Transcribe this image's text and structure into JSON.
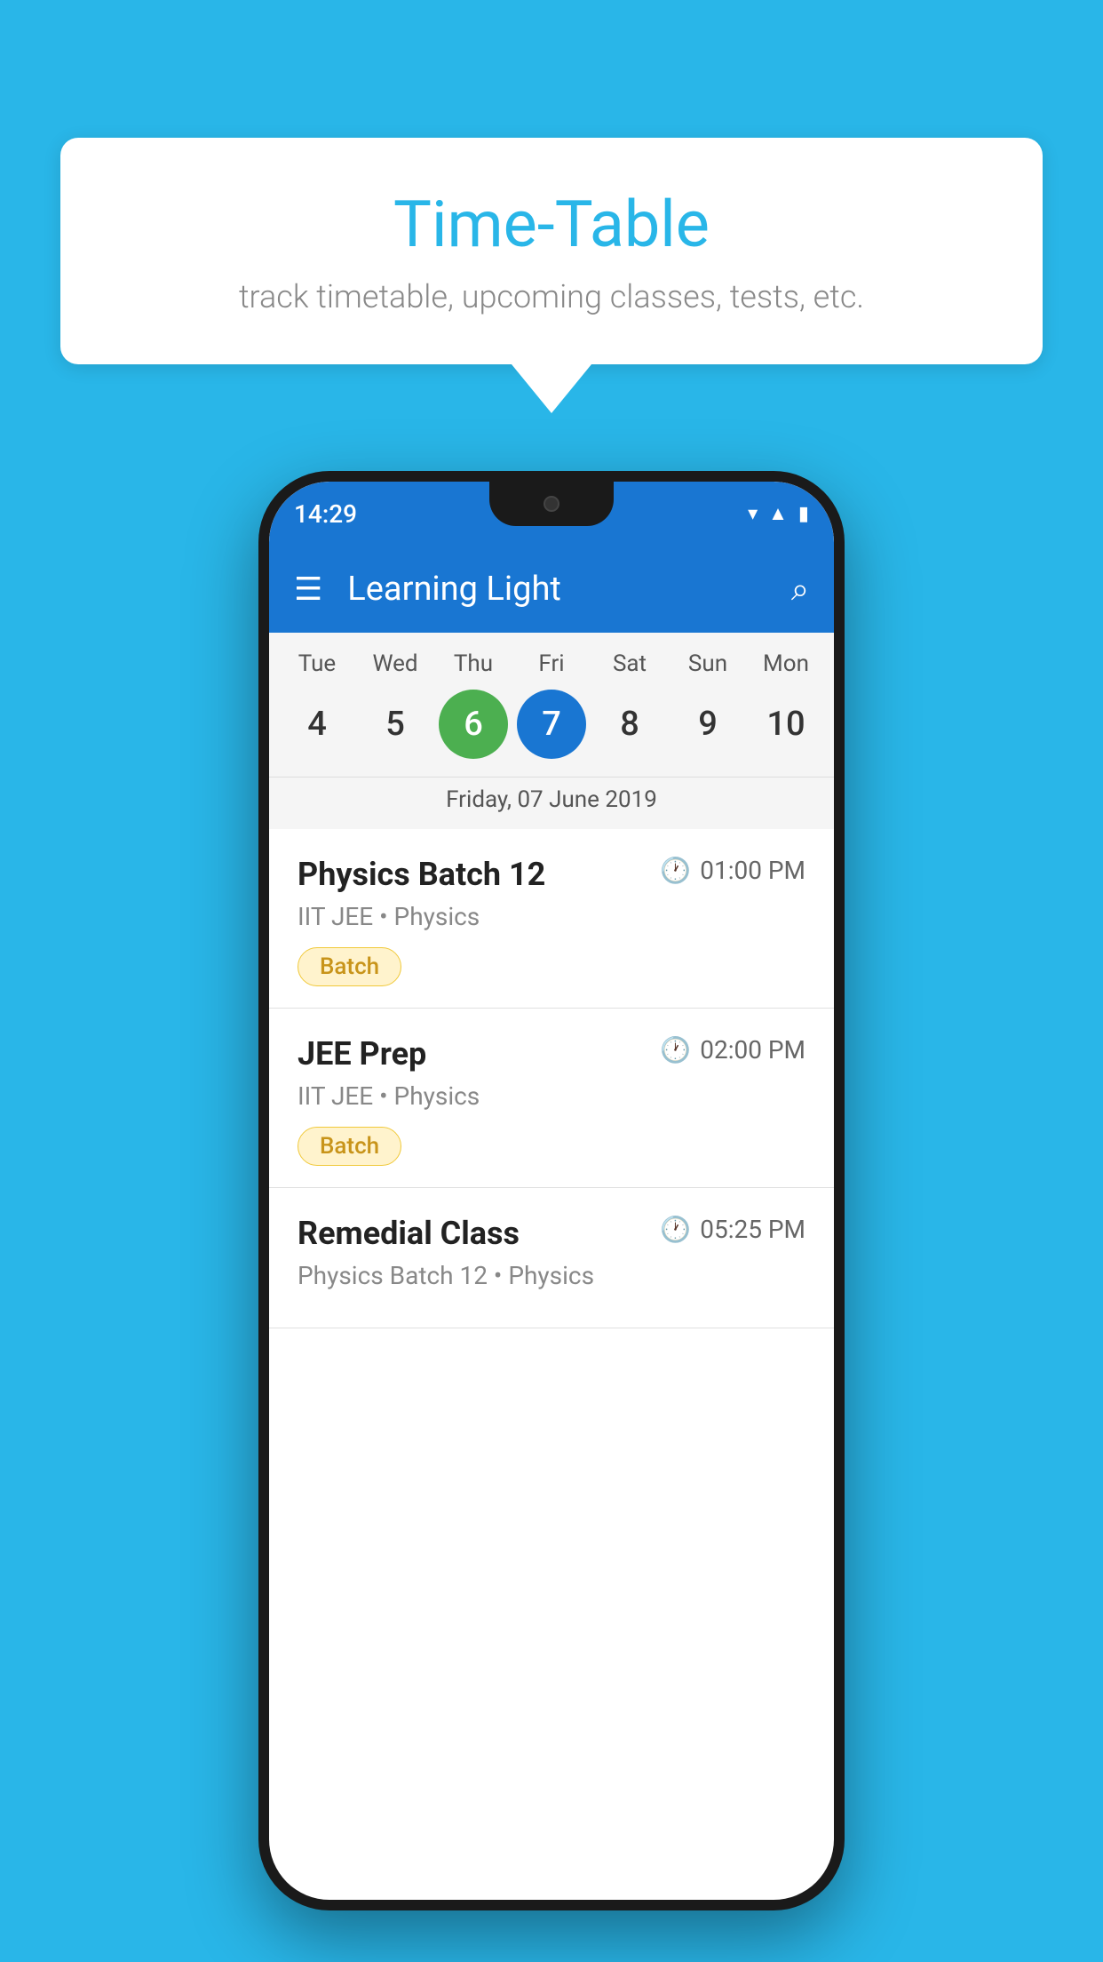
{
  "background": {
    "color": "#29B6E8"
  },
  "speech_bubble": {
    "title": "Time-Table",
    "subtitle": "track timetable, upcoming classes, tests, etc."
  },
  "phone": {
    "status_bar": {
      "time": "14:29"
    },
    "app_bar": {
      "title": "Learning Light"
    },
    "calendar": {
      "days": [
        {
          "label": "Tue",
          "number": "4",
          "state": "normal"
        },
        {
          "label": "Wed",
          "number": "5",
          "state": "normal"
        },
        {
          "label": "Thu",
          "number": "6",
          "state": "today"
        },
        {
          "label": "Fri",
          "number": "7",
          "state": "selected"
        },
        {
          "label": "Sat",
          "number": "8",
          "state": "normal"
        },
        {
          "label": "Sun",
          "number": "9",
          "state": "normal"
        },
        {
          "label": "Mon",
          "number": "10",
          "state": "normal"
        }
      ],
      "selected_date": "Friday, 07 June 2019"
    },
    "schedule": [
      {
        "title": "Physics Batch 12",
        "time": "01:00 PM",
        "subtitle": "IIT JEE • Physics",
        "badge": "Batch"
      },
      {
        "title": "JEE Prep",
        "time": "02:00 PM",
        "subtitle": "IIT JEE • Physics",
        "badge": "Batch"
      },
      {
        "title": "Remedial Class",
        "time": "05:25 PM",
        "subtitle": "Physics Batch 12 • Physics",
        "badge": ""
      }
    ]
  }
}
